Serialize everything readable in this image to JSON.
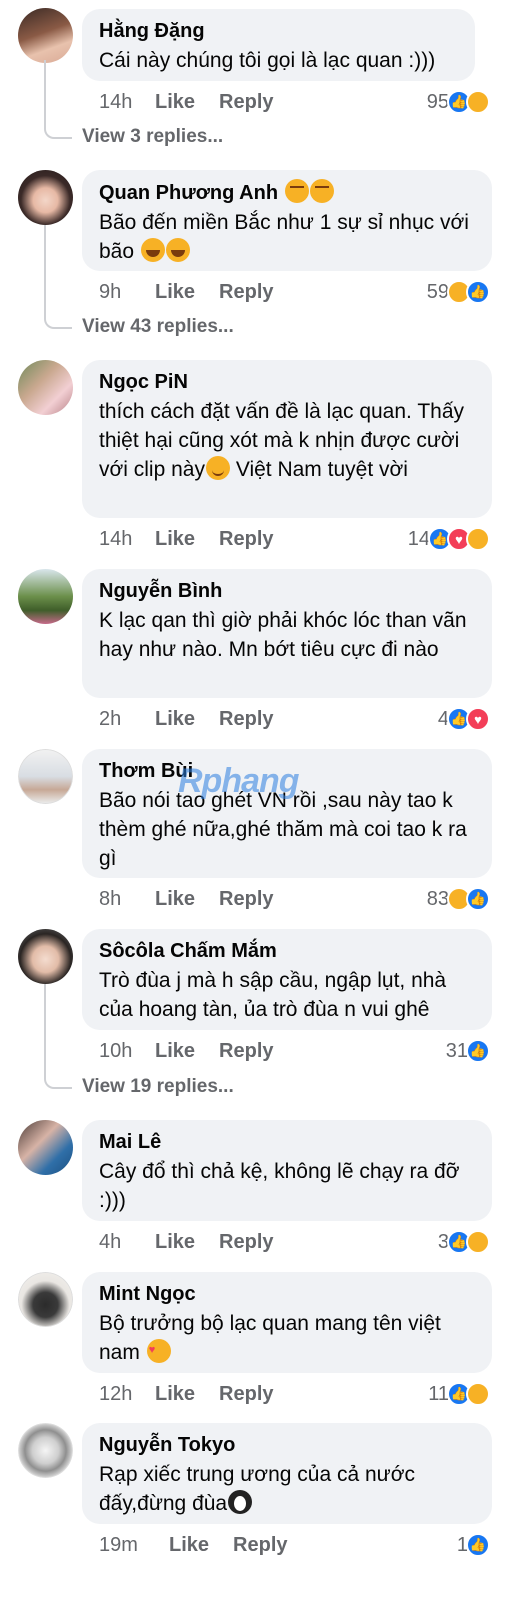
{
  "comments": [
    {
      "name": "Hằng Đặng",
      "text": "Cái này chúng tôi gọi là lạc quan :)))",
      "time": "14h",
      "count": "95",
      "replies": "View 3 replies..."
    },
    {
      "name": "Quan Phương Anh",
      "text": "Bão đến miền Bắc như 1 sự sỉ nhục với bão",
      "time": "9h",
      "count": "59",
      "replies": "View 43 replies..."
    },
    {
      "name": "Ngọc PiN",
      "text": "thích cách đặt vấn đề là lạc quan. Thấy thiệt hại cũng xót mà k nhịn được cười với clip này",
      "text2": " Việt Nam tuyệt vời",
      "time": "14h",
      "count": "14"
    },
    {
      "name": "Nguyễn Bình",
      "text": "K lạc qan thì giờ phải khóc lóc than vãn hay như nào. Mn bớt tiêu cực đi nào",
      "time": "2h",
      "count": "4"
    },
    {
      "name": "Thơm Bùi",
      "text": "Bão nói tao ghét VN rồi ,sau này tao k thèm ghé nữa,ghé thăm mà coi tao k ra gì",
      "time": "8h",
      "count": "83"
    },
    {
      "name": "Sôcôla Chấm Mắm",
      "text": "Trò đùa j mà h sập cầu, ngập lụt, nhà của hoang tàn, ủa trò đùa n vui ghê",
      "time": "10h",
      "count": "31",
      "replies": "View 19 replies..."
    },
    {
      "name": "Mai Lê",
      "text": "Cây đổ thì chả kệ, không lẽ chạy ra đỡ :)))",
      "time": "4h",
      "count": "3"
    },
    {
      "name": "Mint Ngọc",
      "text": "Bộ trưởng bộ lạc quan mang tên việt nam",
      "time": "12h",
      "count": "11"
    },
    {
      "name": "Nguyễn Tokyo",
      "text": "Rạp xiếc trung ương của cả nước đấy,đừng đùa",
      "time": "19m",
      "count": "1"
    }
  ],
  "actions": {
    "like": "Like",
    "reply": "Reply"
  },
  "watermark": "Rphang",
  "colors": {
    "bubble": "#f0f2f5",
    "meta": "#65676b",
    "like": "#1877f2",
    "haha": "#f7b125",
    "love": "#f33e58"
  }
}
